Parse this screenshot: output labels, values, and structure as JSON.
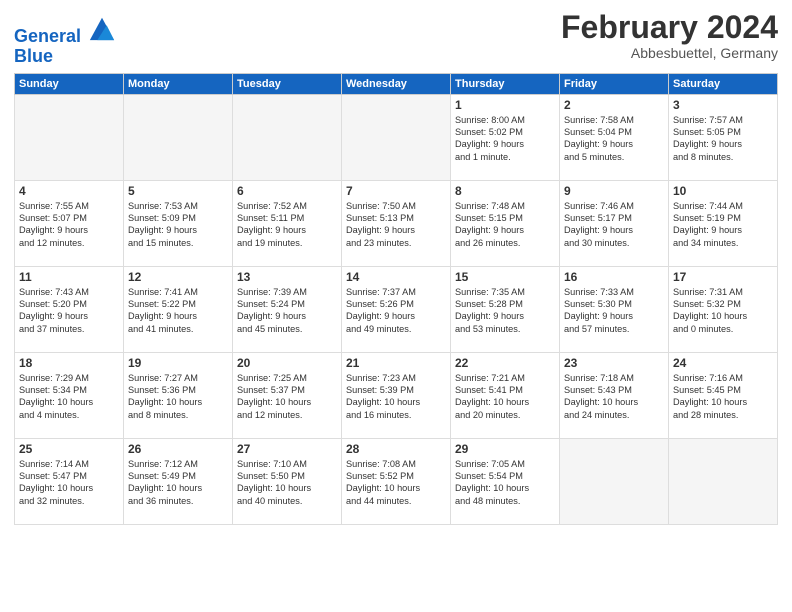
{
  "header": {
    "logo_line1": "General",
    "logo_line2": "Blue",
    "month_year": "February 2024",
    "location": "Abbesbuettel, Germany"
  },
  "weekdays": [
    "Sunday",
    "Monday",
    "Tuesday",
    "Wednesday",
    "Thursday",
    "Friday",
    "Saturday"
  ],
  "weeks": [
    [
      {
        "day": "",
        "info": ""
      },
      {
        "day": "",
        "info": ""
      },
      {
        "day": "",
        "info": ""
      },
      {
        "day": "",
        "info": ""
      },
      {
        "day": "1",
        "info": "Sunrise: 8:00 AM\nSunset: 5:02 PM\nDaylight: 9 hours\nand 1 minute."
      },
      {
        "day": "2",
        "info": "Sunrise: 7:58 AM\nSunset: 5:04 PM\nDaylight: 9 hours\nand 5 minutes."
      },
      {
        "day": "3",
        "info": "Sunrise: 7:57 AM\nSunset: 5:05 PM\nDaylight: 9 hours\nand 8 minutes."
      }
    ],
    [
      {
        "day": "4",
        "info": "Sunrise: 7:55 AM\nSunset: 5:07 PM\nDaylight: 9 hours\nand 12 minutes."
      },
      {
        "day": "5",
        "info": "Sunrise: 7:53 AM\nSunset: 5:09 PM\nDaylight: 9 hours\nand 15 minutes."
      },
      {
        "day": "6",
        "info": "Sunrise: 7:52 AM\nSunset: 5:11 PM\nDaylight: 9 hours\nand 19 minutes."
      },
      {
        "day": "7",
        "info": "Sunrise: 7:50 AM\nSunset: 5:13 PM\nDaylight: 9 hours\nand 23 minutes."
      },
      {
        "day": "8",
        "info": "Sunrise: 7:48 AM\nSunset: 5:15 PM\nDaylight: 9 hours\nand 26 minutes."
      },
      {
        "day": "9",
        "info": "Sunrise: 7:46 AM\nSunset: 5:17 PM\nDaylight: 9 hours\nand 30 minutes."
      },
      {
        "day": "10",
        "info": "Sunrise: 7:44 AM\nSunset: 5:19 PM\nDaylight: 9 hours\nand 34 minutes."
      }
    ],
    [
      {
        "day": "11",
        "info": "Sunrise: 7:43 AM\nSunset: 5:20 PM\nDaylight: 9 hours\nand 37 minutes."
      },
      {
        "day": "12",
        "info": "Sunrise: 7:41 AM\nSunset: 5:22 PM\nDaylight: 9 hours\nand 41 minutes."
      },
      {
        "day": "13",
        "info": "Sunrise: 7:39 AM\nSunset: 5:24 PM\nDaylight: 9 hours\nand 45 minutes."
      },
      {
        "day": "14",
        "info": "Sunrise: 7:37 AM\nSunset: 5:26 PM\nDaylight: 9 hours\nand 49 minutes."
      },
      {
        "day": "15",
        "info": "Sunrise: 7:35 AM\nSunset: 5:28 PM\nDaylight: 9 hours\nand 53 minutes."
      },
      {
        "day": "16",
        "info": "Sunrise: 7:33 AM\nSunset: 5:30 PM\nDaylight: 9 hours\nand 57 minutes."
      },
      {
        "day": "17",
        "info": "Sunrise: 7:31 AM\nSunset: 5:32 PM\nDaylight: 10 hours\nand 0 minutes."
      }
    ],
    [
      {
        "day": "18",
        "info": "Sunrise: 7:29 AM\nSunset: 5:34 PM\nDaylight: 10 hours\nand 4 minutes."
      },
      {
        "day": "19",
        "info": "Sunrise: 7:27 AM\nSunset: 5:36 PM\nDaylight: 10 hours\nand 8 minutes."
      },
      {
        "day": "20",
        "info": "Sunrise: 7:25 AM\nSunset: 5:37 PM\nDaylight: 10 hours\nand 12 minutes."
      },
      {
        "day": "21",
        "info": "Sunrise: 7:23 AM\nSunset: 5:39 PM\nDaylight: 10 hours\nand 16 minutes."
      },
      {
        "day": "22",
        "info": "Sunrise: 7:21 AM\nSunset: 5:41 PM\nDaylight: 10 hours\nand 20 minutes."
      },
      {
        "day": "23",
        "info": "Sunrise: 7:18 AM\nSunset: 5:43 PM\nDaylight: 10 hours\nand 24 minutes."
      },
      {
        "day": "24",
        "info": "Sunrise: 7:16 AM\nSunset: 5:45 PM\nDaylight: 10 hours\nand 28 minutes."
      }
    ],
    [
      {
        "day": "25",
        "info": "Sunrise: 7:14 AM\nSunset: 5:47 PM\nDaylight: 10 hours\nand 32 minutes."
      },
      {
        "day": "26",
        "info": "Sunrise: 7:12 AM\nSunset: 5:49 PM\nDaylight: 10 hours\nand 36 minutes."
      },
      {
        "day": "27",
        "info": "Sunrise: 7:10 AM\nSunset: 5:50 PM\nDaylight: 10 hours\nand 40 minutes."
      },
      {
        "day": "28",
        "info": "Sunrise: 7:08 AM\nSunset: 5:52 PM\nDaylight: 10 hours\nand 44 minutes."
      },
      {
        "day": "29",
        "info": "Sunrise: 7:05 AM\nSunset: 5:54 PM\nDaylight: 10 hours\nand 48 minutes."
      },
      {
        "day": "",
        "info": ""
      },
      {
        "day": "",
        "info": ""
      }
    ]
  ]
}
